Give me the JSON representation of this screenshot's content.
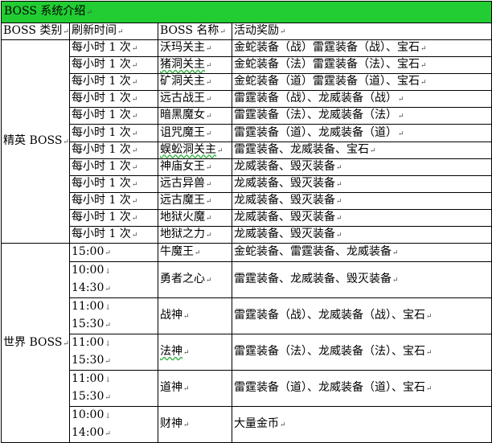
{
  "title": "BOSS 系统介绍",
  "headers": [
    "BOSS 类别",
    "刷新时间",
    "BOSS 名称",
    "活动奖励"
  ],
  "elite": {
    "category": "精英 BOSS",
    "rows": [
      {
        "time": "每小时 1 次",
        "name": "沃玛关主",
        "reward": "金蛇装备（战）雷霆装备（战）、宝石"
      },
      {
        "time": "每小时 1 次",
        "name": "猪洞关主",
        "reward": "金蛇装备（法）雷霆装备（法）、宝石"
      },
      {
        "time": "每小时 1 次",
        "name": "矿洞关主",
        "reward": "金蛇装备（道）雷霆装备（道）、宝石"
      },
      {
        "time": "每小时 1 次",
        "name": "远古战王",
        "reward": "雷霆装备（战）、龙威装备（战）"
      },
      {
        "time": "每小时 1 次",
        "name": "暗黑魔女",
        "reward": "雷霆装备（法）、龙威装备（法）"
      },
      {
        "time": "每小时 1 次",
        "name": "诅咒魔王",
        "reward": "雷霆装备（道）、龙威装备（道）"
      },
      {
        "time": "每小时 1 次",
        "name": "蜈蚣洞关主",
        "reward": "雷霆装备、龙威装备、宝石"
      },
      {
        "time": "每小时 1 次",
        "name": "神庙女王",
        "reward": "龙威装备、毁灭装备"
      },
      {
        "time": "每小时 1 次",
        "name": "远古异兽",
        "reward": "龙威装备、毁灭装备"
      },
      {
        "time": "每小时 1 次",
        "name": "远古魔王",
        "reward": "龙威装备、毁灭装备"
      },
      {
        "time": "每小时 1 次",
        "name": "地狱火魔",
        "reward": "龙威装备、毁灭装备"
      },
      {
        "time": "每小时 1 次",
        "name": "地狱之力",
        "reward": "龙威装备、毁灭装备"
      }
    ]
  },
  "world": {
    "category": "世界 BOSS",
    "rows": [
      {
        "times": [
          "15:00"
        ],
        "name": "牛魔王",
        "reward": "金蛇装备、雷霆装备、龙威装备"
      },
      {
        "times": [
          "10:00",
          "14:30"
        ],
        "name": "勇者之心",
        "reward": "雷霆装备、龙威装备、毁灭装备"
      },
      {
        "times": [
          "11:00",
          "15:30"
        ],
        "name": "战神",
        "reward": "雷霆装备（战）、龙威装备（战）、宝石"
      },
      {
        "times": [
          "11:00",
          "15:30"
        ],
        "name": "法神",
        "reward": "雷霆装备（法）、龙威装备（法）、宝石"
      },
      {
        "times": [
          "11:00",
          "15:30"
        ],
        "name": "道神",
        "reward": "雷霆装备（道）、龙威装备（道）、宝石"
      },
      {
        "times": [
          "10:00",
          "14:00"
        ],
        "name": "财神",
        "reward": "大量金币"
      }
    ]
  },
  "marks": {
    "paragraph": "↵",
    "linebreak": "↓"
  }
}
